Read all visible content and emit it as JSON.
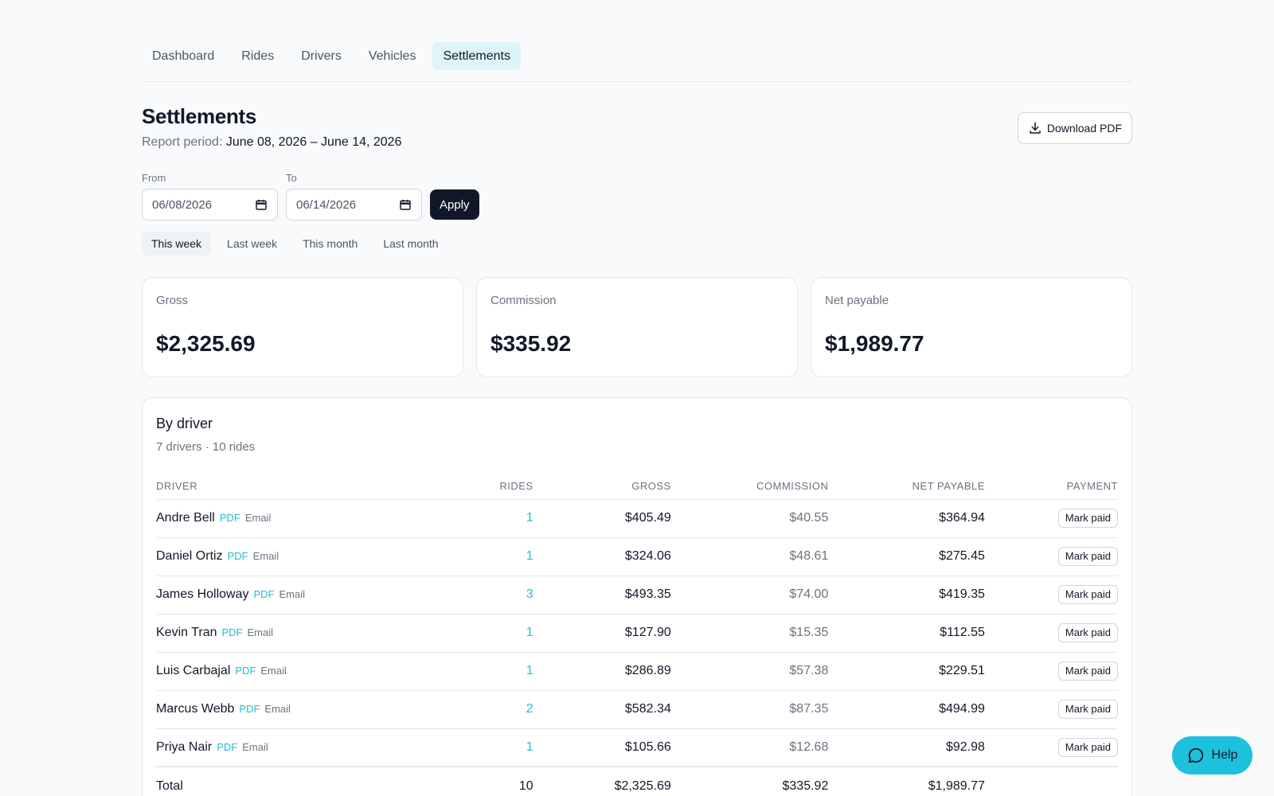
{
  "nav": {
    "tabs": [
      {
        "label": "Dashboard"
      },
      {
        "label": "Rides"
      },
      {
        "label": "Drivers"
      },
      {
        "label": "Vehicles"
      },
      {
        "label": "Settlements",
        "active": true
      }
    ]
  },
  "header": {
    "title": "Settlements",
    "period_label": "Report period:",
    "period_value": "June 08, 2026 – June 14, 2026",
    "download_label": "Download PDF",
    "download_icon": "download-icon"
  },
  "filters": {
    "from_label": "From",
    "from_value": "06/08/2026",
    "to_label": "To",
    "to_value": "06/14/2026",
    "calendar_icon": "calendar-icon",
    "apply_label": "Apply",
    "presets": [
      "This week",
      "Last week",
      "This month",
      "Last month"
    ],
    "active_preset": "This week"
  },
  "summary": {
    "gross_label": "Gross",
    "gross_value": "$2,325.69",
    "commission_label": "Commission",
    "commission_value": "$335.92",
    "net_label": "Net payable",
    "net_value": "$1,989.77"
  },
  "by_driver": {
    "title": "By driver",
    "subtitle": "7 drivers · 10 rides",
    "columns": [
      "DRIVER",
      "RIDES",
      "GROSS",
      "COMMISSION",
      "NET PAYABLE",
      "PAYMENT"
    ],
    "pdf_label": "PDF",
    "email_label": "Email",
    "mark_paid_label": "Mark paid",
    "rows": [
      {
        "name": "Andre Bell",
        "rides": "1",
        "gross": "$405.49",
        "commission": "$40.55",
        "net": "$364.94"
      },
      {
        "name": "Daniel Ortiz",
        "rides": "1",
        "gross": "$324.06",
        "commission": "$48.61",
        "net": "$275.45"
      },
      {
        "name": "James Holloway",
        "rides": "3",
        "gross": "$493.35",
        "commission": "$74.00",
        "net": "$419.35"
      },
      {
        "name": "Kevin Tran",
        "rides": "1",
        "gross": "$127.90",
        "commission": "$15.35",
        "net": "$112.55"
      },
      {
        "name": "Luis Carbajal",
        "rides": "1",
        "gross": "$286.89",
        "commission": "$57.38",
        "net": "$229.51"
      },
      {
        "name": "Marcus Webb",
        "rides": "2",
        "gross": "$582.34",
        "commission": "$87.35",
        "net": "$494.99"
      },
      {
        "name": "Priya Nair",
        "rides": "1",
        "gross": "$105.66",
        "commission": "$12.68",
        "net": "$92.98"
      }
    ],
    "total": {
      "label": "Total",
      "rides": "10",
      "gross": "$2,325.69",
      "commission": "$335.92",
      "net": "$1,989.77"
    }
  },
  "help": {
    "label": "Help",
    "icon": "chat-bubble-icon"
  },
  "colors": {
    "accent": "#1ec1dc",
    "link": "#22bcd6",
    "active_tab_bg": "#dff4f8",
    "primary_button": "#111827"
  }
}
